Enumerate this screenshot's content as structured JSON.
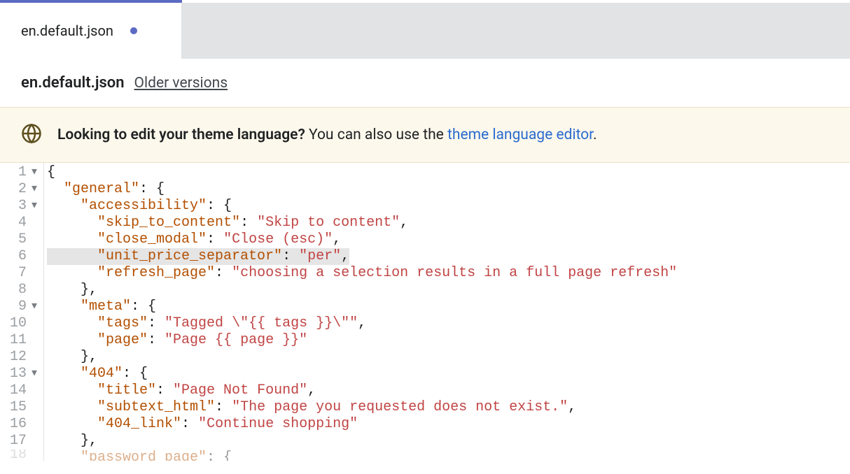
{
  "tab": {
    "label": "en.default.json"
  },
  "subheader": {
    "filename": "en.default.json",
    "older_versions": "Older versions"
  },
  "banner": {
    "bold": "Looking to edit your theme language?",
    "rest": " You can also use the ",
    "link": "theme language editor",
    "period": "."
  },
  "code": {
    "lines": [
      {
        "n": "1",
        "fold": "▾",
        "parts": [
          [
            "pun",
            "{"
          ]
        ]
      },
      {
        "n": "2",
        "fold": "▾",
        "parts": [
          [
            "pun",
            "  "
          ],
          [
            "key",
            "\"general\""
          ],
          [
            "pun",
            ": {"
          ]
        ]
      },
      {
        "n": "3",
        "fold": "▾",
        "parts": [
          [
            "pun",
            "    "
          ],
          [
            "key",
            "\"accessibility\""
          ],
          [
            "pun",
            ": {"
          ]
        ]
      },
      {
        "n": "4",
        "fold": "",
        "parts": [
          [
            "pun",
            "      "
          ],
          [
            "key",
            "\"skip_to_content\""
          ],
          [
            "pun",
            ": "
          ],
          [
            "str",
            "\"Skip to content\""
          ],
          [
            "pun",
            ","
          ]
        ]
      },
      {
        "n": "5",
        "fold": "",
        "parts": [
          [
            "pun",
            "      "
          ],
          [
            "key",
            "\"close_modal\""
          ],
          [
            "pun",
            ": "
          ],
          [
            "str",
            "\"Close (esc)\""
          ],
          [
            "pun",
            ","
          ]
        ]
      },
      {
        "n": "6",
        "fold": "",
        "hl": true,
        "parts": [
          [
            "pun",
            "      "
          ],
          [
            "key",
            "\"unit_price_separator\""
          ],
          [
            "pun",
            ": "
          ],
          [
            "str",
            "\"per\""
          ],
          [
            "pun",
            ","
          ]
        ]
      },
      {
        "n": "7",
        "fold": "",
        "parts": [
          [
            "pun",
            "      "
          ],
          [
            "key",
            "\"refresh_page\""
          ],
          [
            "pun",
            ": "
          ],
          [
            "str",
            "\"choosing a selection results in a full page refresh\""
          ]
        ]
      },
      {
        "n": "8",
        "fold": "",
        "parts": [
          [
            "pun",
            "    },"
          ]
        ]
      },
      {
        "n": "9",
        "fold": "▾",
        "parts": [
          [
            "pun",
            "    "
          ],
          [
            "key",
            "\"meta\""
          ],
          [
            "pun",
            ": {"
          ]
        ]
      },
      {
        "n": "10",
        "fold": "",
        "parts": [
          [
            "pun",
            "      "
          ],
          [
            "key",
            "\"tags\""
          ],
          [
            "pun",
            ": "
          ],
          [
            "str",
            "\"Tagged \\\"{{ tags }}\\\"\""
          ],
          [
            "pun",
            ","
          ]
        ]
      },
      {
        "n": "11",
        "fold": "",
        "parts": [
          [
            "pun",
            "      "
          ],
          [
            "key",
            "\"page\""
          ],
          [
            "pun",
            ": "
          ],
          [
            "str",
            "\"Page {{ page }}\""
          ]
        ]
      },
      {
        "n": "12",
        "fold": "",
        "parts": [
          [
            "pun",
            "    },"
          ]
        ]
      },
      {
        "n": "13",
        "fold": "▾",
        "parts": [
          [
            "pun",
            "    "
          ],
          [
            "key",
            "\"404\""
          ],
          [
            "pun",
            ": {"
          ]
        ]
      },
      {
        "n": "14",
        "fold": "",
        "parts": [
          [
            "pun",
            "      "
          ],
          [
            "key",
            "\"title\""
          ],
          [
            "pun",
            ": "
          ],
          [
            "str",
            "\"Page Not Found\""
          ],
          [
            "pun",
            ","
          ]
        ]
      },
      {
        "n": "15",
        "fold": "",
        "parts": [
          [
            "pun",
            "      "
          ],
          [
            "key",
            "\"subtext_html\""
          ],
          [
            "pun",
            ": "
          ],
          [
            "str",
            "\"The page you requested does not exist.\""
          ],
          [
            "pun",
            ","
          ]
        ]
      },
      {
        "n": "16",
        "fold": "",
        "parts": [
          [
            "pun",
            "      "
          ],
          [
            "key",
            "\"404_link\""
          ],
          [
            "pun",
            ": "
          ],
          [
            "str",
            "\"Continue shopping\""
          ]
        ]
      },
      {
        "n": "17",
        "fold": "",
        "parts": [
          [
            "pun",
            "    },"
          ]
        ]
      },
      {
        "n": "18",
        "fold": "",
        "partial": true,
        "parts": [
          [
            "pun",
            "    "
          ],
          [
            "key",
            "\"password_page\""
          ],
          [
            "pun",
            ": {"
          ]
        ]
      }
    ]
  }
}
